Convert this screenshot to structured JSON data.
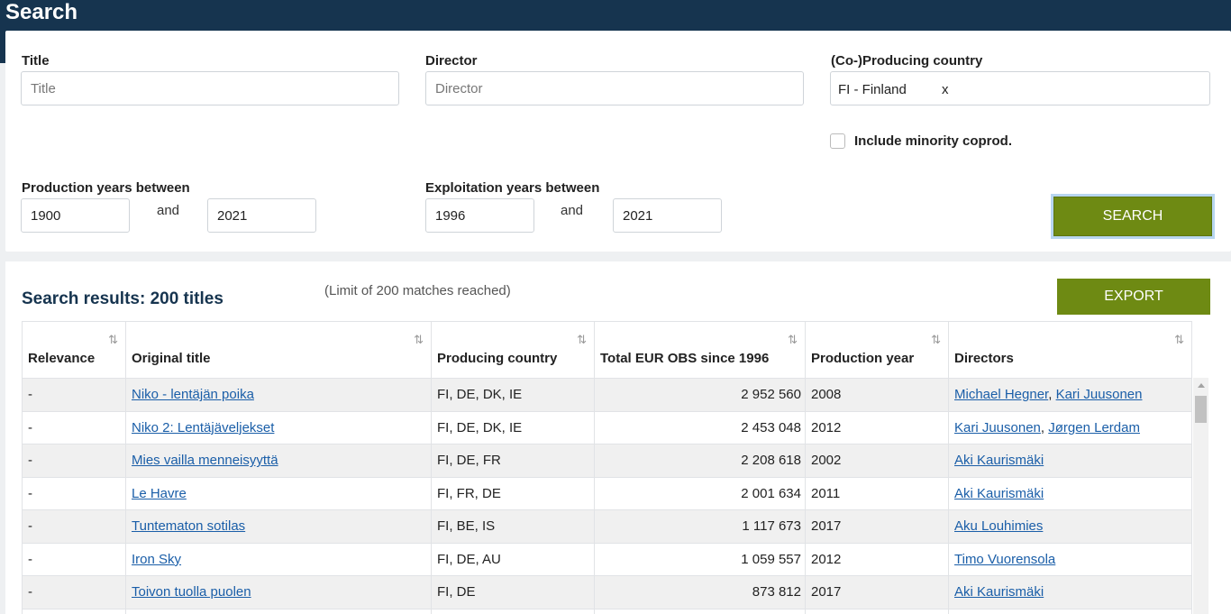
{
  "header": {
    "title": "Search"
  },
  "form": {
    "title_label": "Title",
    "title_placeholder": "Title",
    "director_label": "Director",
    "director_placeholder": "Director",
    "country_label": "(Co-)Producing country",
    "country_tag": "FI - Finland",
    "country_remove": "x",
    "minority_label": "Include minority coprod.",
    "prod_years_label": "Production years between",
    "prod_from": "1900",
    "prod_to": "2021",
    "exp_years_label": "Exploitation years between",
    "exp_from": "1996",
    "exp_to": "2021",
    "and_text": "and",
    "search_label": "SEARCH"
  },
  "results": {
    "title": "Search results: 200 titles",
    "limit_note": "(Limit of 200 matches reached)",
    "export_label": "EXPORT",
    "sort_icon": "⇅",
    "columns": {
      "relevance": "Relevance",
      "original_title": "Original title",
      "producing_country": "Producing country",
      "total_eur": "Total EUR OBS since 1996",
      "production_year": "Production year",
      "directors": "Directors"
    },
    "rows": [
      {
        "relevance": "-",
        "title": "Niko - lentäjän poika",
        "country": "FI, DE, DK, IE",
        "total": "2 952 560",
        "year": "2008",
        "directors": [
          "Michael Hegner",
          "Kari Juusonen"
        ]
      },
      {
        "relevance": "-",
        "title": "Niko 2: Lentäjäveljekset",
        "country": "FI, DE, DK, IE",
        "total": "2 453 048",
        "year": "2012",
        "directors": [
          "Kari Juusonen",
          "Jørgen Lerdam"
        ]
      },
      {
        "relevance": "-",
        "title": "Mies vailla menneisyyttä",
        "country": "FI, DE, FR",
        "total": "2 208 618",
        "year": "2002",
        "directors": [
          "Aki Kaurismäki"
        ]
      },
      {
        "relevance": "-",
        "title": "Le Havre",
        "country": "FI, FR, DE",
        "total": "2 001 634",
        "year": "2011",
        "directors": [
          "Aki Kaurismäki"
        ]
      },
      {
        "relevance": "-",
        "title": "Tuntematon sotilas",
        "country": "FI, BE, IS",
        "total": "1 117 673",
        "year": "2017",
        "directors": [
          "Aku Louhimies"
        ]
      },
      {
        "relevance": "-",
        "title": "Iron Sky",
        "country": "FI, DE, AU",
        "total": "1 059 557",
        "year": "2012",
        "directors": [
          "Timo Vuorensola"
        ]
      },
      {
        "relevance": "-",
        "title": "Toivon tuolla puolen",
        "country": "FI, DE",
        "total": "873 812",
        "year": "2017",
        "directors": [
          "Aki Kaurismäki"
        ]
      },
      {
        "relevance": "",
        "title": "",
        "country": "",
        "total": "",
        "year": "",
        "directors": []
      }
    ]
  }
}
